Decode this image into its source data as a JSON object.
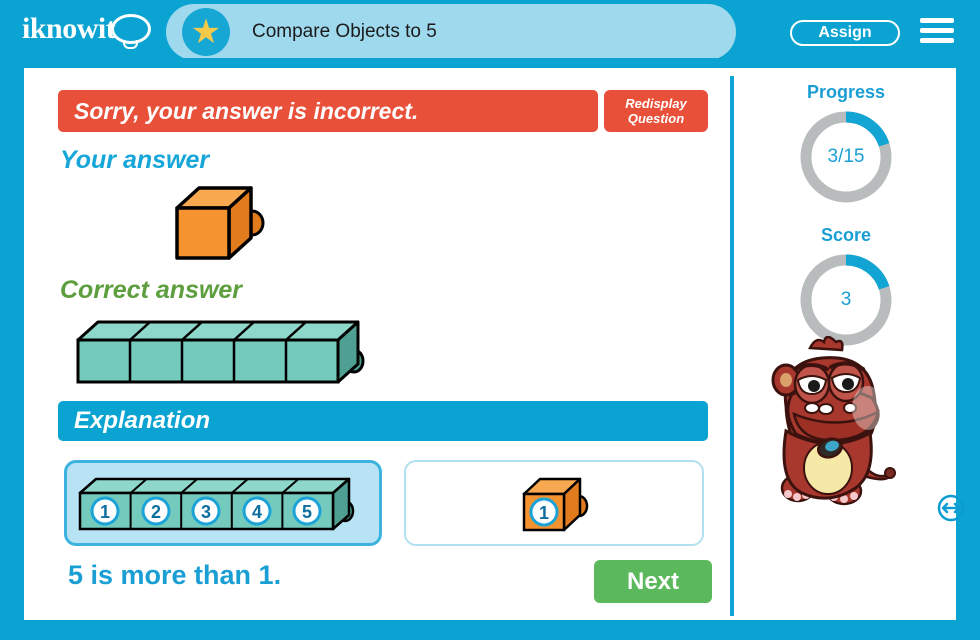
{
  "header": {
    "logo_text": "iknowit",
    "logo_icon": "lightbulb-icon",
    "star_icon": "star-icon",
    "title": "Compare Objects to 5",
    "assign_label": "Assign",
    "menu_icon": "hamburger-menu-icon",
    "bar_color": "#0aa3d2",
    "title_pill_color": "#9fd9ed"
  },
  "feedback": {
    "message": "Sorry, your answer is incorrect.",
    "banner_color": "#e8503a",
    "redisplay_line1": "Redisplay",
    "redisplay_line2": "Question"
  },
  "your_answer": {
    "label": "Your answer",
    "label_color": "#17a6d9",
    "cube_count": 1,
    "cube_color": "#f59331"
  },
  "correct_answer": {
    "label": "Correct answer",
    "label_color": "#5d9e3f",
    "cube_count": 5,
    "cube_color": "#74cbbd"
  },
  "explanation": {
    "heading": "Explanation",
    "heading_bar_color": "#0aa3d2",
    "left_group": {
      "cube_count": 5,
      "cube_color": "#74cbbd",
      "numbers": [
        "1",
        "2",
        "3",
        "4",
        "5"
      ],
      "selected": true
    },
    "right_group": {
      "cube_count": 1,
      "cube_color": "#f59331",
      "numbers": [
        "1"
      ],
      "selected": false
    },
    "conclusion": "5 is more than 1.",
    "conclusion_color": "#1a9fd4"
  },
  "footer": {
    "next_label": "Next",
    "next_color": "#5cb85c"
  },
  "sidebar": {
    "progress": {
      "label": "Progress",
      "value_text": "3/15",
      "percent": 20,
      "fill_color": "#12a5d4",
      "track_color": "#b8bcbd"
    },
    "score": {
      "label": "Score",
      "value_text": "3",
      "percent": 20,
      "fill_color": "#12a5d4",
      "track_color": "#b8bcbd"
    },
    "mascot_icon": "monster-mascot-icon",
    "resize_icon": "resize-arrows-icon"
  }
}
